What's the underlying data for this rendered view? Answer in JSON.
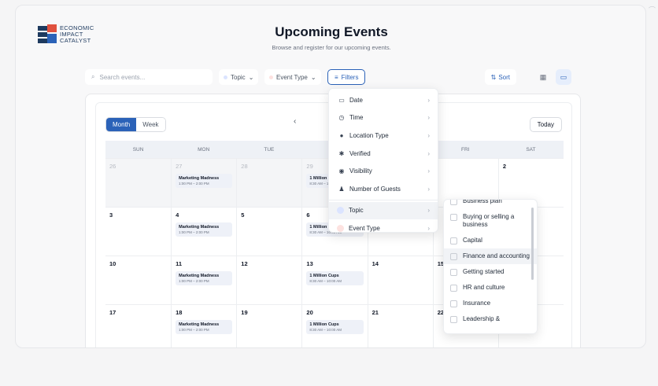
{
  "brand": {
    "line1": "ECONOMIC",
    "line2": "IMPACT",
    "line3": "CATALYST"
  },
  "header": {
    "title": "Upcoming Events",
    "subtitle": "Browse and register for our upcoming events."
  },
  "toolbar": {
    "search_placeholder": "Search events...",
    "topic_label": "Topic",
    "event_type_label": "Event Type",
    "filters_label": "Filters",
    "sort_label": "Sort"
  },
  "calendar": {
    "month_label": "Month",
    "week_label": "Week",
    "today_label": "Today",
    "days": [
      "SUN",
      "MON",
      "TUE",
      "WED",
      "THU",
      "FRI",
      "SAT"
    ],
    "weeks": [
      [
        {
          "d": "26",
          "dim": true
        },
        {
          "d": "27",
          "dim": true,
          "ev": {
            "t": "Marketing Madness",
            "tm": "1:00 PM – 2:00 PM"
          }
        },
        {
          "d": "28",
          "dim": true
        },
        {
          "d": "29",
          "dim": true,
          "ev": {
            "t": "1 Million Cups",
            "tm": "8:30 AM – 10:00 AM"
          }
        },
        {
          "d": ""
        },
        {
          "d": ""
        },
        {
          "d": "2"
        }
      ],
      [
        {
          "d": "3"
        },
        {
          "d": "4",
          "ev": {
            "t": "Marketing Madness",
            "tm": "1:00 PM – 2:00 PM"
          }
        },
        {
          "d": "5"
        },
        {
          "d": "6",
          "ev": {
            "t": "1 Million Cups",
            "tm": "8:30 AM – 10:00 AM"
          }
        },
        {
          "d": ""
        },
        {
          "d": ""
        },
        {
          "d": ""
        }
      ],
      [
        {
          "d": "10"
        },
        {
          "d": "11",
          "ev": {
            "t": "Marketing Madness",
            "tm": "1:00 PM – 2:00 PM"
          }
        },
        {
          "d": "12"
        },
        {
          "d": "13",
          "ev": {
            "t": "1 Million Cups",
            "tm": "8:30 AM – 10:00 AM"
          }
        },
        {
          "d": "14"
        },
        {
          "d": "15"
        },
        {
          "d": ""
        }
      ],
      [
        {
          "d": "17"
        },
        {
          "d": "18",
          "ev": {
            "t": "Marketing Madness",
            "tm": "1:00 PM – 2:00 PM"
          }
        },
        {
          "d": "19"
        },
        {
          "d": "20",
          "ev": {
            "t": "1 Million Cups",
            "tm": "8:30 AM – 10:00 AM"
          }
        },
        {
          "d": "21"
        },
        {
          "d": "22"
        },
        {
          "d": ""
        }
      ]
    ]
  },
  "filters_menu": {
    "items": [
      {
        "label": "Date",
        "icon": "calendar-icon",
        "glyph": "▭"
      },
      {
        "label": "Time",
        "icon": "clock-icon",
        "glyph": "◷"
      },
      {
        "label": "Location Type",
        "icon": "pin-icon",
        "glyph": "●"
      },
      {
        "label": "Verified",
        "icon": "verified-icon",
        "glyph": "✱"
      },
      {
        "label": "Visibility",
        "icon": "eye-icon",
        "glyph": "◉"
      },
      {
        "label": "Number of Guests",
        "icon": "guests-icon",
        "glyph": "♟"
      }
    ],
    "topic": "Topic",
    "event_type": "Event Type"
  },
  "topic_submenu": {
    "items": [
      "Business plan",
      "Buying or selling a business",
      "Capital",
      "Finance and accounting",
      "Getting started",
      "HR and culture",
      "Insurance",
      "Leadership &"
    ]
  },
  "colors": {
    "accent": "#2b62b8",
    "topic_dot": "#dbe4ff",
    "event_type_dot": "#fde2e0"
  }
}
